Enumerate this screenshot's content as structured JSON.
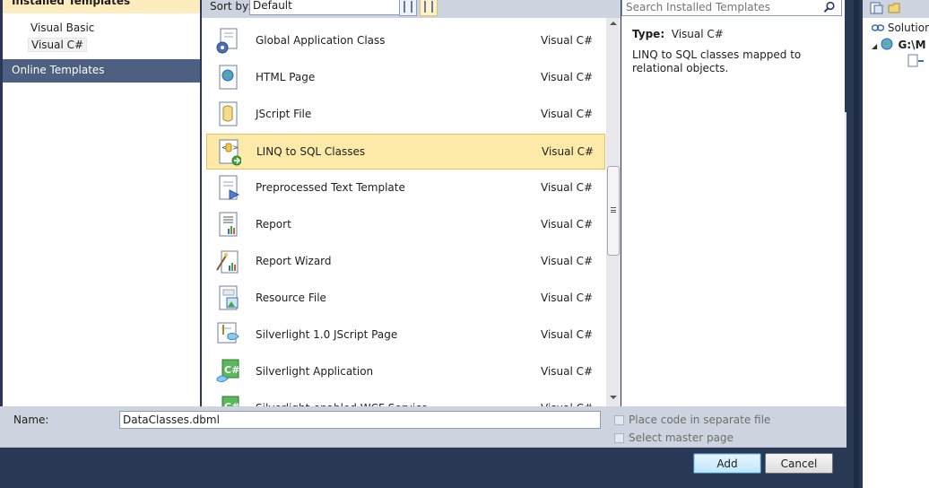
{
  "left_panel": {
    "installed_header": "Installed Templates",
    "tree": [
      {
        "label": "Visual Basic"
      },
      {
        "label": "Visual C#"
      }
    ],
    "online_templates": "Online Templates"
  },
  "sort_bar": {
    "label": "Sort by:",
    "selected": "Default"
  },
  "templates": [
    {
      "name": "Global Application Class",
      "lang": "Visual C#",
      "icon": "global-app-icon"
    },
    {
      "name": "HTML Page",
      "lang": "Visual C#",
      "icon": "html-page-icon"
    },
    {
      "name": "JScript File",
      "lang": "Visual C#",
      "icon": "jscript-icon"
    },
    {
      "name": "LINQ to SQL Classes",
      "lang": "Visual C#",
      "icon": "linq-sql-icon",
      "selected": true
    },
    {
      "name": "Preprocessed Text Template",
      "lang": "Visual C#",
      "icon": "text-template-icon"
    },
    {
      "name": "Report",
      "lang": "Visual C#",
      "icon": "report-icon"
    },
    {
      "name": "Report Wizard",
      "lang": "Visual C#",
      "icon": "report-wizard-icon"
    },
    {
      "name": "Resource File",
      "lang": "Visual C#",
      "icon": "resource-file-icon"
    },
    {
      "name": "Silverlight 1.0 JScript Page",
      "lang": "Visual C#",
      "icon": "silverlight-jscript-icon"
    },
    {
      "name": "Silverlight Application",
      "lang": "Visual C#",
      "icon": "silverlight-app-icon"
    },
    {
      "name": "Silverlight-enabled WCF Service",
      "lang": "Visual C#",
      "icon": "silverlight-wcf-icon"
    }
  ],
  "details": {
    "search_placeholder": "Search Installed Templates",
    "type_label": "Type:",
    "type_value": "Visual C#",
    "description": "LINQ to SQL classes mapped to relational objects."
  },
  "bottom": {
    "name_label": "Name:",
    "name_value": "DataClasses.dbml",
    "place_code_label": "Place code in separate file",
    "select_master_label": "Select master page",
    "add_label": "Add",
    "cancel_label": "Cancel"
  },
  "solution_explorer": {
    "row1": "Solution",
    "row2": "G:\\M"
  },
  "colors": {
    "accent_dark": "#293955",
    "selected_row": "#fdeaa8",
    "panel_header": "#ced4df"
  }
}
